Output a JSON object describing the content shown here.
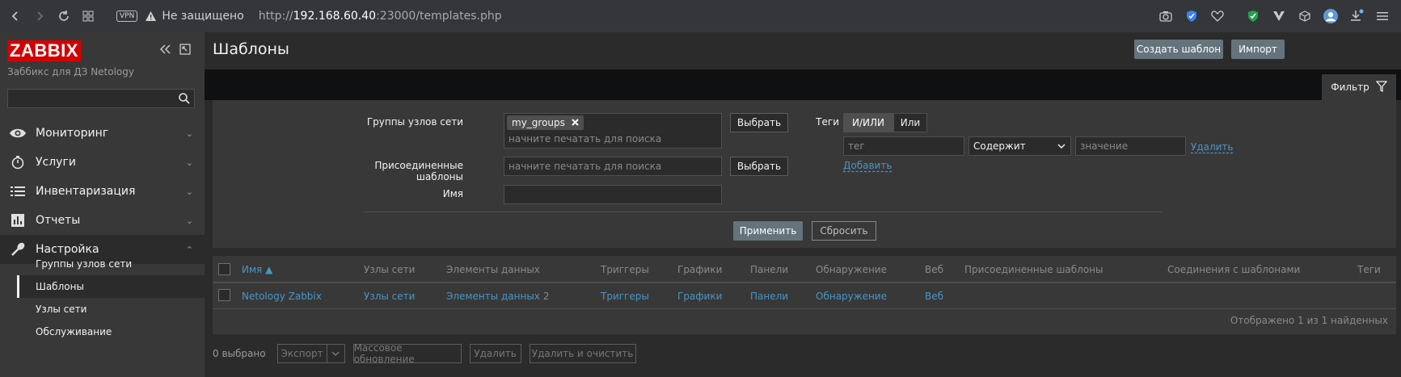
{
  "browser": {
    "vpn": "VPN",
    "security": "Не защищено",
    "url_prefix": "http://",
    "url_host": "192.168.60.40",
    "url_rest": ":23000/templates.php"
  },
  "sidebar": {
    "logo": "ZABBIX",
    "subtitle": "Заббикс для ДЗ Netology",
    "search_value": "",
    "menu": [
      {
        "label": "Мониторинг",
        "icon": "eye-icon"
      },
      {
        "label": "Услуги",
        "icon": "clock-icon"
      },
      {
        "label": "Инвентаризация",
        "icon": "list-icon"
      },
      {
        "label": "Отчеты",
        "icon": "bar-chart-icon"
      },
      {
        "label": "Настройка",
        "icon": "wrench-icon"
      }
    ],
    "submenu": [
      {
        "label": "Группы узлов сети"
      },
      {
        "label": "Шаблоны"
      },
      {
        "label": "Узлы сети"
      },
      {
        "label": "Обслуживание"
      }
    ]
  },
  "header": {
    "title": "Шаблоны",
    "create_button": "Создать шаблон",
    "import_button": "Импорт"
  },
  "filter": {
    "tab_label": "Фильтр",
    "host_groups_label": "Группы узлов сети",
    "host_groups_chip": "my_groups",
    "host_groups_placeholder": "начните печатать для поиска",
    "select_button": "Выбрать",
    "linked_templates_label": "Присоединенные шаблоны",
    "linked_templates_placeholder": "начните печатать для поиска",
    "name_label": "Имя",
    "name_value": "",
    "tags_label": "Теги",
    "tags_and_or": "И/ИЛИ",
    "tags_or": "Или",
    "tag_placeholder": "тег",
    "tag_operator": "Содержит",
    "tag_value_placeholder": "значение",
    "remove_link": "Удалить",
    "add_link": "Добавить",
    "apply_button": "Применить",
    "reset_button": "Сбросить"
  },
  "table": {
    "columns": [
      "Имя ▲",
      "Узлы сети",
      "Элементы данных",
      "Триггеры",
      "Графики",
      "Панели",
      "Обнаружение",
      "Веб",
      "Присоединенные шаблоны",
      "Соединения с шаблонами",
      "Теги"
    ],
    "row": {
      "name": "Netology Zabbix",
      "hosts": "Узлы сети",
      "items": "Элементы данных",
      "items_count": "2",
      "triggers": "Триггеры",
      "graphs": "Графики",
      "dashboards": "Панели",
      "discovery": "Обнаружение",
      "web": "Веб"
    },
    "footer": "Отображено 1 из 1 найденных"
  },
  "bulk": {
    "selected": "0 выбрано",
    "export": "Экспорт",
    "mass_update": "Массовое обновление",
    "delete": "Удалить",
    "delete_clear": "Удалить и очистить"
  },
  "colors": {
    "logo_red": "#d40000",
    "link_blue": "#4796c4",
    "primary_button": "#65747c"
  }
}
